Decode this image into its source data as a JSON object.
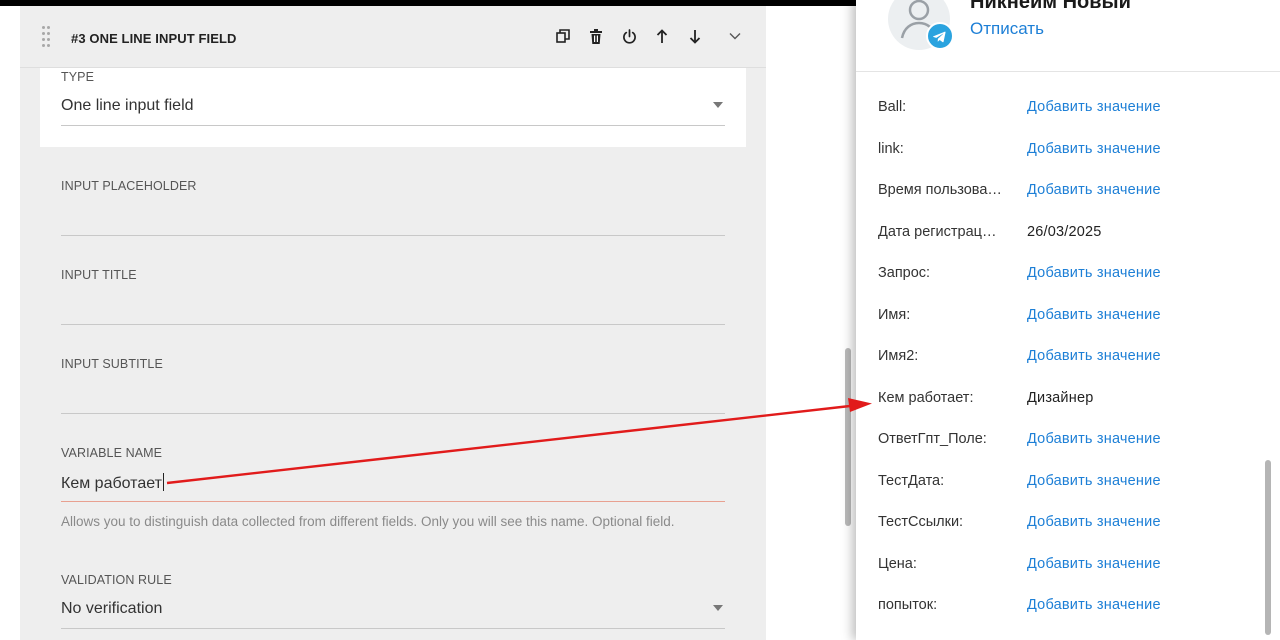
{
  "editor": {
    "block_title": "#3 ONE LINE INPUT FIELD",
    "icons": [
      "copy-icon",
      "trash-icon",
      "power-icon",
      "arrow-up-icon",
      "arrow-down-icon",
      "chevron-down-icon"
    ],
    "type": {
      "label": "TYPE",
      "value": "One line input field"
    },
    "placeholder": {
      "label": "INPUT PLACEHOLDER",
      "value": ""
    },
    "title": {
      "label": "INPUT TITLE",
      "value": ""
    },
    "subtitle": {
      "label": "INPUT SUBTITLE",
      "value": ""
    },
    "variable": {
      "label": "VARIABLE NAME",
      "value": "Кем работает",
      "hint": "Allows you to distinguish data collected from different fields. Only you will see this name. Optional field."
    },
    "validation": {
      "label": "VALIDATION RULE",
      "value": "No verification"
    }
  },
  "panel": {
    "name": "Никнейм Новый",
    "unsubscribe": "Отписать",
    "rows": [
      {
        "key": "Ball:",
        "value": "Добавить значение",
        "is_link": true
      },
      {
        "key": "link:",
        "value": "Добавить значение",
        "is_link": true
      },
      {
        "key": "Время пользова…",
        "value": "Добавить значение",
        "is_link": true
      },
      {
        "key": "Дата регистрац…",
        "value": "26/03/2025",
        "is_link": false
      },
      {
        "key": "Запрос:",
        "value": "Добавить значение",
        "is_link": true
      },
      {
        "key": "Имя:",
        "value": "Добавить значение",
        "is_link": true
      },
      {
        "key": "Имя2:",
        "value": "Добавить значение",
        "is_link": true
      },
      {
        "key": "Кем работает:",
        "value": "Дизайнер",
        "is_link": false
      },
      {
        "key": "ОтветГпт_Поле:",
        "value": "Добавить значение",
        "is_link": true
      },
      {
        "key": "ТестДата:",
        "value": "Добавить значение",
        "is_link": true
      },
      {
        "key": "ТестСсылки:",
        "value": "Добавить значение",
        "is_link": true
      },
      {
        "key": "Цена:",
        "value": "Добавить значение",
        "is_link": true
      },
      {
        "key": "попыток:",
        "value": "Добавить значение",
        "is_link": true
      }
    ]
  },
  "colors": {
    "link": "#1d7fd6",
    "accent_underline": "#e8a090",
    "annotation_arrow": "#e11b1b",
    "telegram": "#2aa3df"
  }
}
